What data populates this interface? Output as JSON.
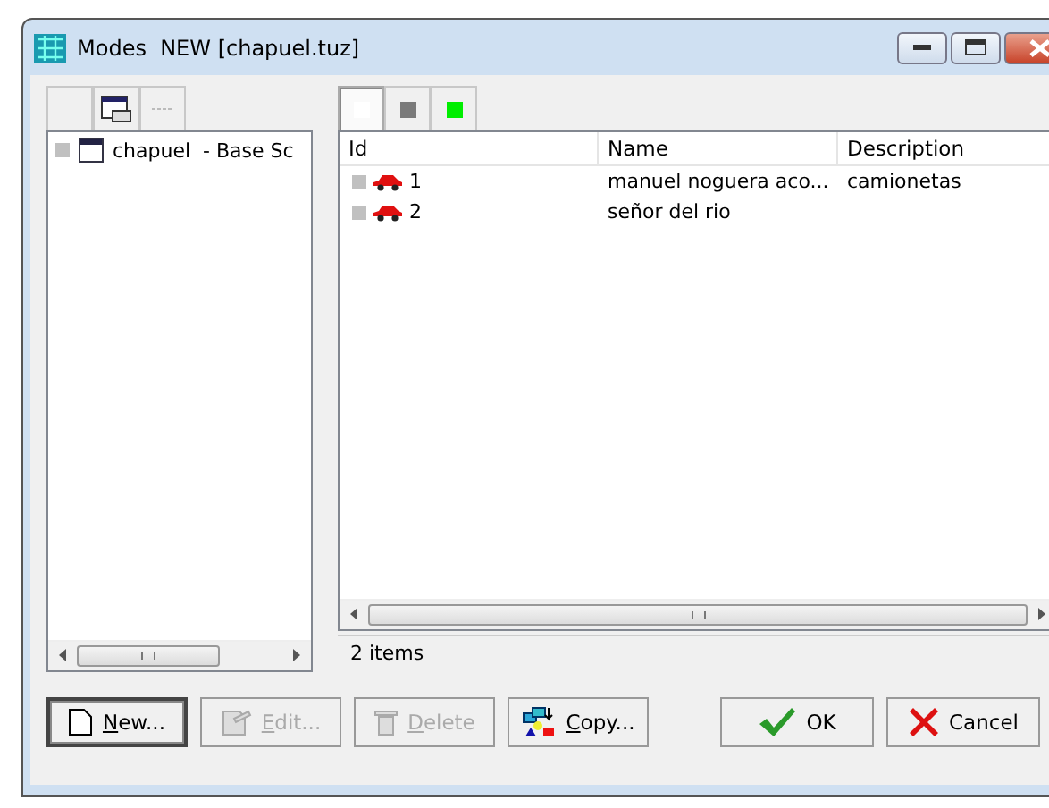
{
  "window": {
    "title": "Modes  NEW [chapuel.tuz]"
  },
  "tree": {
    "items": [
      {
        "label": "chapuel  - Base Sc",
        "selected": false
      }
    ]
  },
  "view_modes": [
    {
      "kind": "white",
      "selected": true
    },
    {
      "kind": "gray",
      "selected": false
    },
    {
      "kind": "green",
      "selected": false
    }
  ],
  "table": {
    "columns": [
      "Id",
      "Name",
      "Description"
    ],
    "rows": [
      {
        "id": "1",
        "name": "manuel noguera aco...",
        "description": "camionetas",
        "selected": false
      },
      {
        "id": "2",
        "name": "señor del rio",
        "description": "",
        "selected": false
      }
    ]
  },
  "status_bar": "2 items",
  "buttons": [
    {
      "kind": "new",
      "label": "New...",
      "disabled": false
    },
    {
      "kind": "edit",
      "label": "Edit...",
      "disabled": true
    },
    {
      "kind": "delete",
      "label": "Delete",
      "disabled": true
    },
    {
      "kind": "copy",
      "label": "Copy...",
      "disabled": false
    },
    {
      "kind": "ok",
      "label": "OK",
      "disabled": false
    },
    {
      "kind": "cancel",
      "label": "Cancel",
      "disabled": false
    }
  ]
}
